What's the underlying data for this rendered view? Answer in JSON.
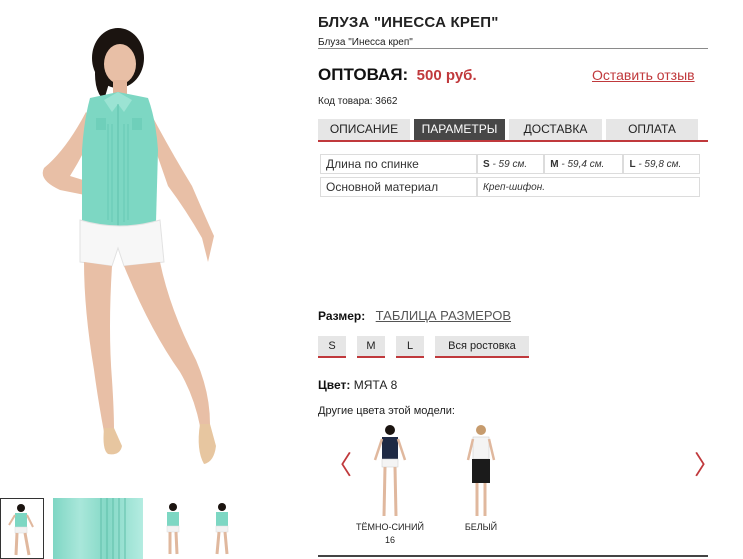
{
  "product": {
    "title": "БЛУЗА \"ИНЕССА КРЕП\"",
    "subtitle": "Блуза \"Инесса креп\"",
    "price_label": "ОПТОВАЯ:",
    "price_value": "500 руб.",
    "review_link": "Оставить отзыв",
    "sku": "Код товара: 3662"
  },
  "tabs": [
    {
      "label": "ОПИСАНИЕ",
      "active": false
    },
    {
      "label": "ПАРАМЕТРЫ",
      "active": true
    },
    {
      "label": "ДОСТАВКА",
      "active": false
    },
    {
      "label": "ОПЛАТА",
      "active": false
    }
  ],
  "params": {
    "rows": [
      {
        "name": "Длина по спинке",
        "values": [
          {
            "size": "S",
            "value": " - 59 см."
          },
          {
            "size": "M",
            "value": " - 59,4 см."
          },
          {
            "size": "L",
            "value": " - 59,8 см."
          }
        ]
      },
      {
        "name": "Основной материал",
        "value": "Креп-шифон."
      }
    ]
  },
  "sizes": {
    "label": "Размер:",
    "table_link": "ТАБЛИЦА РАЗМЕРОВ",
    "options": [
      "S",
      "M",
      "L",
      "Вся ростовка"
    ]
  },
  "color": {
    "label": "Цвет:",
    "value": "МЯТА 8",
    "other_label": "Другие цвета этой модели:",
    "swatches": [
      {
        "caption_line1": "ТЁМНО-СИНИЙ",
        "caption_line2": "16",
        "top_color": "#1f2a44"
      },
      {
        "caption_line1": "БЕЛЫЙ",
        "caption_line2": "",
        "top_color": "#f4f4f4"
      }
    ],
    "prev_arrow": "〈",
    "next_arrow": "〉"
  },
  "colors": {
    "accent": "#c0393c",
    "blouse": "#7dd7c3",
    "tab_active": "#474747",
    "tab_inactive": "#e6e6e6"
  }
}
